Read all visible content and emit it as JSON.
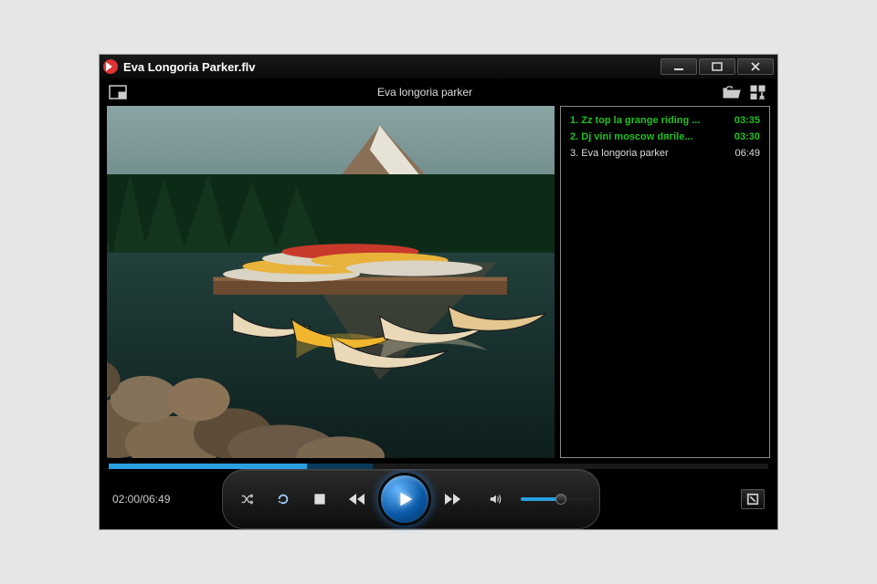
{
  "window": {
    "title": "Eva Longoria Parker.flv"
  },
  "toolbar": {
    "now_playing": "Eva longoria parker"
  },
  "playback": {
    "elapsed": "02:00",
    "total": "06:49",
    "time_display": "02:00/06:49",
    "progress_percent": 30,
    "buffer_percent": 40,
    "volume_percent": 55
  },
  "playlist": [
    {
      "index": 1,
      "title": "Zz top la grange riding ...",
      "duration": "03:35",
      "state": "done"
    },
    {
      "index": 2,
      "title": "Dj vini moscow dягile...",
      "duration": "03:30",
      "state": "done"
    },
    {
      "index": 3,
      "title": "Eva longoria parker",
      "duration": "06:49",
      "state": "current"
    }
  ]
}
